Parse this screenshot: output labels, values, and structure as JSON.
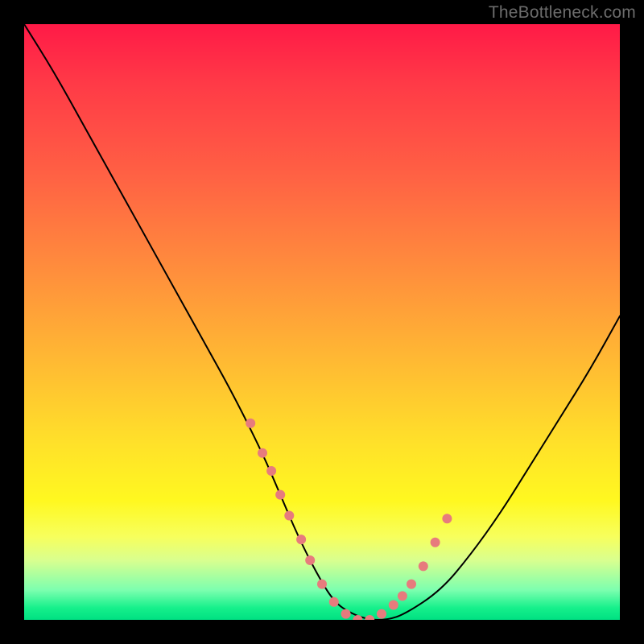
{
  "watermark": "TheBottleneck.com",
  "chart_data": {
    "type": "line",
    "title": "",
    "xlabel": "",
    "ylabel": "",
    "xlim": [
      0,
      100
    ],
    "ylim": [
      0,
      100
    ],
    "series": [
      {
        "name": "bottleneck-curve",
        "x": [
          0,
          5,
          10,
          15,
          20,
          25,
          30,
          35,
          40,
          43,
          46,
          49,
          52,
          55,
          58,
          61,
          64,
          70,
          75,
          80,
          85,
          90,
          95,
          100
        ],
        "y": [
          100,
          92,
          83,
          74,
          65,
          56,
          47,
          38,
          28,
          21,
          14,
          8,
          3,
          1,
          0,
          0,
          1,
          5,
          11,
          18,
          26,
          34,
          42,
          51
        ]
      }
    ],
    "highlight_points": {
      "name": "optimal-range-dots",
      "color": "#e77b7d",
      "x": [
        38,
        40,
        41.5,
        43,
        44.5,
        46.5,
        48,
        50,
        52,
        54,
        56,
        58,
        60,
        62,
        63.5,
        65,
        67,
        69,
        71
      ],
      "y": [
        33,
        28,
        25,
        21,
        17.5,
        13.5,
        10,
        6,
        3,
        1,
        0,
        0,
        1,
        2.5,
        4,
        6,
        9,
        13,
        17
      ]
    }
  }
}
